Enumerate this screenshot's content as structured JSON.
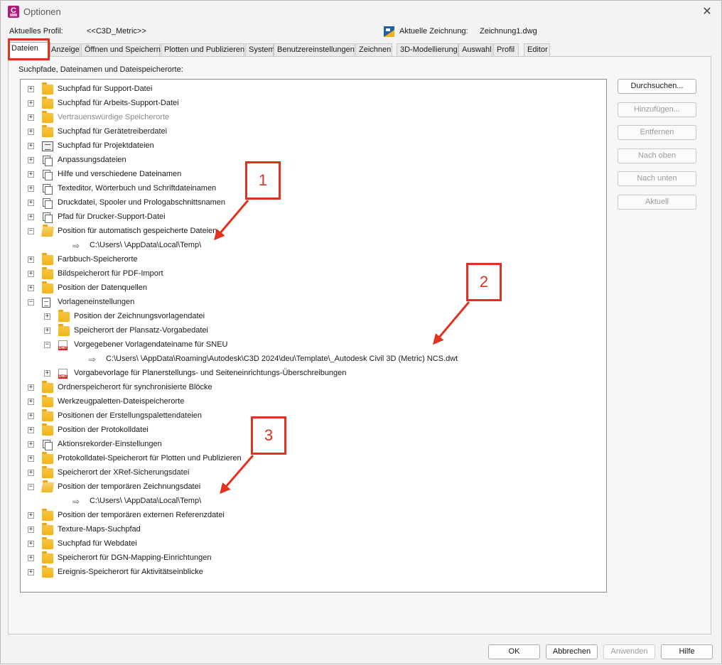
{
  "window": {
    "title": "Optionen",
    "app_icon_letter": "C"
  },
  "profile": {
    "label": "Aktuelles Profil:",
    "value": "<<C3D_Metric>>",
    "drawing_label": "Aktuelle Zeichnung:",
    "drawing_value": "Zeichnung1.dwg"
  },
  "tabs": [
    "Dateien",
    "Anzeige",
    "Öffnen und Speichern",
    "Plotten und Publizieren",
    "System",
    "Benutzereinstellungen",
    "Zeichnen",
    "3D-Modellierung",
    "Auswahl",
    "Profil",
    "Editor"
  ],
  "panel_label": "Suchpfade, Dateinamen und Dateispeicherorte:",
  "tree": [
    {
      "label": "Suchpfad für Support-Datei",
      "icon": "folder-icon",
      "expander": "+"
    },
    {
      "label": "Suchpfad für Arbeits-Support-Datei",
      "icon": "folder-icon",
      "expander": "+"
    },
    {
      "label": "Vertrauenswürdige Speicherorte",
      "icon": "folder-icon",
      "expander": "+",
      "gray": true
    },
    {
      "label": "Suchpfad für Gerätetreiberdatei",
      "icon": "folder-icon",
      "expander": "+"
    },
    {
      "label": "Suchpfad für Projektdateien",
      "icon": "project-icon",
      "expander": "+"
    },
    {
      "label": "Anpassungsdateien",
      "icon": "pages-icon",
      "expander": "+"
    },
    {
      "label": "Hilfe und verschiedene Dateinamen",
      "icon": "pages-icon",
      "expander": "+"
    },
    {
      "label": "Texteditor, Wörterbuch und Schriftdateinamen",
      "icon": "pages-icon",
      "expander": "+"
    },
    {
      "label": "Druckdatei, Spooler und Prologabschnittsnamen",
      "icon": "pages-icon",
      "expander": "+"
    },
    {
      "label": "Pfad für Drucker-Support-Datei",
      "icon": "pages-icon",
      "expander": "+"
    },
    {
      "label": "Position für automatisch gespeicherte Dateien",
      "icon": "open-folder-icon",
      "expander": "−"
    },
    {
      "label": "C:\\Users\\      \\AppData\\Local\\Temp\\",
      "icon": "path-arrow-icon",
      "level": 1
    },
    {
      "label": "Farbbuch-Speicherorte",
      "icon": "folder-icon",
      "expander": "+"
    },
    {
      "label": "Bildspeicherort für PDF-Import",
      "icon": "folder-icon",
      "expander": "+"
    },
    {
      "label": "Position der Datenquellen",
      "icon": "folder-icon",
      "expander": "+"
    },
    {
      "label": "Vorlageneinstellungen",
      "icon": "document-icon",
      "expander": "−"
    },
    {
      "label": "Position der Zeichnungsvorlagendatei",
      "icon": "folder-icon",
      "expander": "+",
      "level": 1
    },
    {
      "label": "Speicherort der Plansatz-Vorgabedatei",
      "icon": "folder-icon",
      "expander": "+",
      "level": 1
    },
    {
      "label": "Vorgegebener Vorlagendateiname für SNEU",
      "icon": "dwt-icon",
      "expander": "−",
      "level": 1
    },
    {
      "label": "C:\\Users\\      \\AppData\\Roaming\\Autodesk\\C3D 2024\\deu\\Template\\_Autodesk Civil 3D (Metric) NCS.dwt",
      "icon": "path-arrow-icon",
      "level": 2
    },
    {
      "label": "Vorgabevorlage für Planerstellungs- und Seiteneinrichtungs-Überschreibungen",
      "icon": "dwt-icon",
      "expander": "+",
      "level": 1
    },
    {
      "label": "Ordnerspeicherort für synchronisierte Blöcke",
      "icon": "folder-icon",
      "expander": "+"
    },
    {
      "label": "Werkzeugpaletten-Dateispeicherorte",
      "icon": "folder-icon",
      "expander": "+"
    },
    {
      "label": "Positionen der Erstellungspalettendateien",
      "icon": "folder-icon",
      "expander": "+"
    },
    {
      "label": "Position der Protokolldatei",
      "icon": "folder-icon",
      "expander": "+"
    },
    {
      "label": "Aktionsrekorder-Einstellungen",
      "icon": "pages-icon",
      "expander": "+"
    },
    {
      "label": "Protokolldatei-Speicherort für Plotten und Publizieren",
      "icon": "folder-icon",
      "expander": "+"
    },
    {
      "label": "Speicherort der XRef-Sicherungsdatei",
      "icon": "folder-icon",
      "expander": "+"
    },
    {
      "label": "Position der temporären Zeichnungsdatei",
      "icon": "open-folder-icon",
      "expander": "−"
    },
    {
      "label": "C:\\Users\\      \\AppData\\Local\\Temp\\",
      "icon": "path-arrow-icon",
      "level": 1
    },
    {
      "label": "Position der temporären externen Referenzdatei",
      "icon": "folder-icon",
      "expander": "+"
    },
    {
      "label": "Texture-Maps-Suchpfad",
      "icon": "folder-icon",
      "expander": "+"
    },
    {
      "label": "Suchpfad für Webdatei",
      "icon": "folder-icon",
      "expander": "+"
    },
    {
      "label": "Speicherort für DGN-Mapping-Einrichtungen",
      "icon": "folder-icon",
      "expander": "+"
    },
    {
      "label": "Ereignis-Speicherort für Aktivitätseinblicke",
      "icon": "folder-icon",
      "expander": "+"
    }
  ],
  "side_buttons": [
    {
      "label": "Durchsuchen...",
      "enabled": true
    },
    {
      "label": "Hinzufügen...",
      "enabled": false
    },
    {
      "label": "Entfernen",
      "enabled": false
    },
    {
      "label": "Nach oben",
      "enabled": false
    },
    {
      "label": "Nach unten",
      "enabled": false
    },
    {
      "label": "Aktuell",
      "enabled": false
    }
  ],
  "bottom_buttons": [
    {
      "label": "OK",
      "enabled": true
    },
    {
      "label": "Abbrechen",
      "enabled": true
    },
    {
      "label": "Anwenden",
      "enabled": false
    },
    {
      "label": "Hilfe",
      "enabled": true
    }
  ],
  "annotations": [
    "1",
    "2",
    "3"
  ],
  "colors": {
    "annotation": "#e0321e",
    "folder": "#f1b31c",
    "app_icon": "#b3177c"
  }
}
